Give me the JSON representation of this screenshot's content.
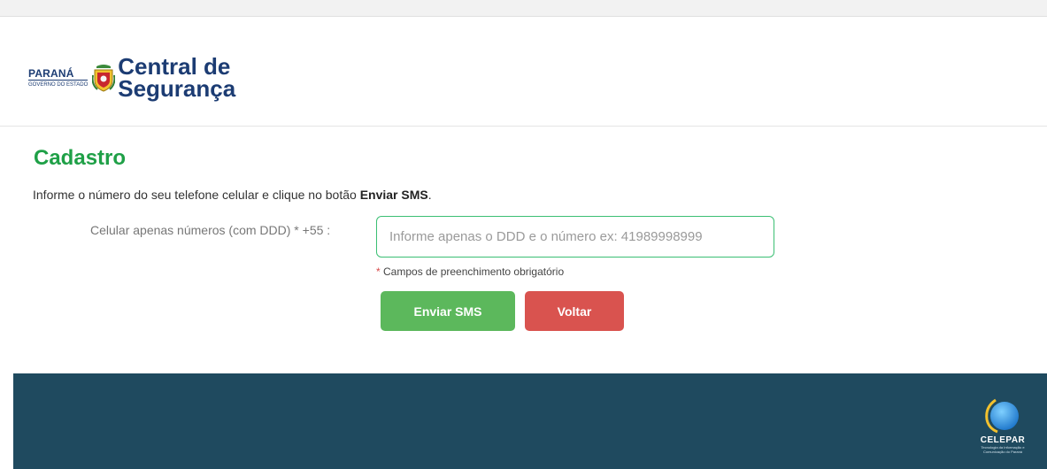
{
  "header": {
    "gov_name": "PARANÁ",
    "gov_sub": "GOVERNO DO ESTADO",
    "brand_line1": "Central de",
    "brand_line2": "Segurança"
  },
  "main": {
    "title": "Cadastro",
    "intro_prefix": "Informe o número do seu telefone celular e clique no botão ",
    "intro_bold": "Enviar SMS",
    "intro_suffix": ".",
    "phone_label": "Celular apenas números (com DDD) * +55 :",
    "phone_value": "",
    "phone_placeholder": "Informe apenas o DDD e o número ex: 41989998999",
    "required_star": "*",
    "required_note": " Campos de preenchimento obrigatório",
    "send_label": "Enviar SMS",
    "back_label": "Voltar"
  },
  "footer": {
    "logo_name": "CELEPAR",
    "logo_sub": "Tecnologia da Informação e Comunicação do Paraná"
  },
  "colors": {
    "brand_blue": "#1c3c73",
    "title_green": "#1fa047",
    "send_green": "#5cb85c",
    "back_red": "#d9534f",
    "footer_bg": "#1f4a5f"
  },
  "icons": {
    "crest": "parana-coat-of-arms-icon",
    "celepar": "celepar-logo-icon"
  }
}
